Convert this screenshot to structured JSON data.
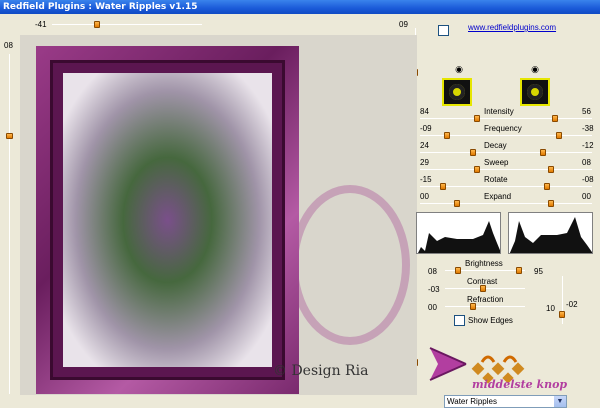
{
  "window": {
    "title": "Redfield Plugins : Water Ripples v1.15"
  },
  "top_slider": {
    "left_value": "-41",
    "right_value": "09"
  },
  "left_slider": {
    "value": "08"
  },
  "link": {
    "text": "www.redfieldplugins.com"
  },
  "controls": {
    "intensity": {
      "label": "Intensity",
      "left": "84",
      "right": "56"
    },
    "frequency": {
      "label": "Frequency",
      "left": "-09",
      "right": "-38"
    },
    "decay": {
      "label": "Decay",
      "left": "24",
      "right": "-12"
    },
    "sweep": {
      "label": "Sweep",
      "left": "29",
      "right": "08"
    },
    "rotate": {
      "label": "Rotate",
      "left": "-15",
      "right": "-08"
    },
    "expand": {
      "label": "Expand",
      "left": "00",
      "right": "00"
    }
  },
  "brightness": {
    "label": "Brightness",
    "left": "08",
    "right": "95"
  },
  "contrast": {
    "label": "Contrast",
    "left": "-03"
  },
  "refraction": {
    "label": "Refraction",
    "left": "00"
  },
  "show_edges": {
    "label": "Show Edges"
  },
  "right_values": {
    "a": "10",
    "b": "-02"
  },
  "copyright": "© Design Ria",
  "logo_text": "middelste knop",
  "preset": {
    "selected": "Water Ripples"
  },
  "colors": {
    "accent": "#e07a00",
    "frame": "#6a1e5e",
    "title": "#1a5ad8"
  },
  "icons": {
    "eye": "eye-icon",
    "dropdown": "chevron-down-icon"
  }
}
